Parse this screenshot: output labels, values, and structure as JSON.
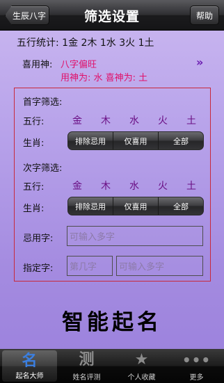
{
  "nav": {
    "back_label": "生辰八字",
    "title": "筛选设置",
    "help_label": "帮助"
  },
  "stats": "五行统计: 1金 2木 1水 3火 1土",
  "xiyong": {
    "label": "喜用神:",
    "bazi_value": "八字偏旺",
    "yongshen_line": "用神为: 水  喜神为: 土",
    "arrow_icon": "double-chevron-right-icon"
  },
  "first": {
    "title": "首字筛选:",
    "wuxing_label": "五行:",
    "wuxing_options": [
      "金",
      "木",
      "水",
      "火",
      "土"
    ],
    "shengxiao_label": "生肖:",
    "segments": [
      "排除忌用",
      "仅喜用",
      "全部"
    ],
    "selected": "none"
  },
  "second": {
    "title": "次字筛选:",
    "wuxing_label": "五行:",
    "wuxing_options": [
      "金",
      "木",
      "水",
      "火",
      "土"
    ],
    "shengxiao_label": "生肖:",
    "segments": [
      "排除忌用",
      "仅喜用",
      "全部"
    ],
    "selected": "none"
  },
  "jiyong": {
    "label": "忌用字:",
    "placeholder": "可输入多字"
  },
  "zhiding": {
    "label": "指定字:",
    "position_placeholder": "第几字",
    "chars_placeholder": "可输入多字"
  },
  "big_title": "智能起名",
  "tabs": [
    {
      "icon": "名",
      "icon_name": "name-icon",
      "label": "起名大师",
      "active": true
    },
    {
      "icon": "测",
      "icon_name": "test-icon",
      "label": "姓名评测",
      "active": false
    },
    {
      "icon": "★",
      "icon_name": "star-icon",
      "label": "个人收藏",
      "active": false
    },
    {
      "icon": "•••",
      "icon_name": "more-icon",
      "label": "更多",
      "active": false
    }
  ],
  "colors": {
    "accent": "#e0106a",
    "wuxing": "#6a0f84",
    "box_border": "#c8283a",
    "tab_active": "#3b7fe0"
  }
}
